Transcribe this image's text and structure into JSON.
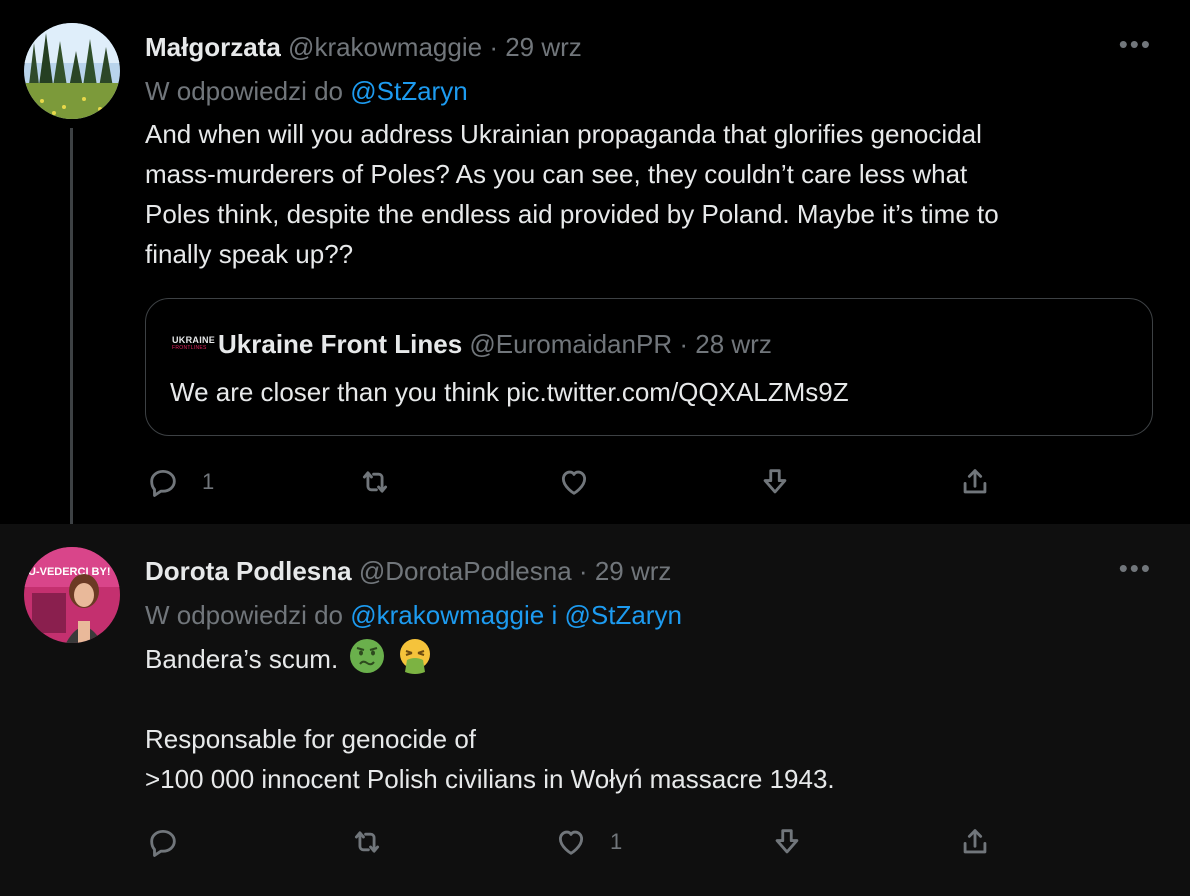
{
  "tweets": [
    {
      "name": "Małgorzata",
      "handle": "@krakowmaggie",
      "separator": "·",
      "date": "29 wrz",
      "more": "•••",
      "reply_prefix": "W odpowiedzi do",
      "reply_targets": "@StZaryn",
      "text_lines": [
        "And when will you address Ukrainian propaganda that glorifies genocidal",
        "mass-murderers of Poles? As you can see, they couldn’t care less what",
        "Poles think, despite the endless aid provided by Poland. Maybe it’s time to",
        "finally speak up??"
      ],
      "quote": {
        "logo_line1": "UKRAINE",
        "logo_line2": "FRONTLINES",
        "name": "Ukraine Front Lines",
        "handle": "@EuromaidanPR",
        "separator": "·",
        "date": "28 wrz",
        "text": "We are closer than you think pic.twitter.com/QQXALZMs9Z"
      },
      "actions": {
        "reply_count": "1",
        "retweet_count": "",
        "like_count": ""
      }
    },
    {
      "name": "Dorota Podlesna",
      "handle": "@DorotaPodlesna",
      "separator": "·",
      "date": "29 wrz",
      "more": "•••",
      "reply_prefix": "W odpowiedzi do",
      "reply_targets": "@krakowmaggie i @StZaryn",
      "text_line1": "Bandera’s scum.",
      "text_lines": [
        "Responsable for genocide of",
        ">100 000 innocent Polish civilians in Wołyń massacre 1943."
      ],
      "emojis": [
        "nauseated-face",
        "vomiting-face"
      ],
      "avatar_text": "U-VEDERCI BY!",
      "actions": {
        "reply_count": "",
        "retweet_count": "",
        "like_count": "1"
      }
    }
  ],
  "colors": {
    "background": "#000000",
    "text": "#e7e9ea",
    "secondary": "#71767b",
    "link": "#1d9bf0",
    "border": "#3d4144"
  }
}
